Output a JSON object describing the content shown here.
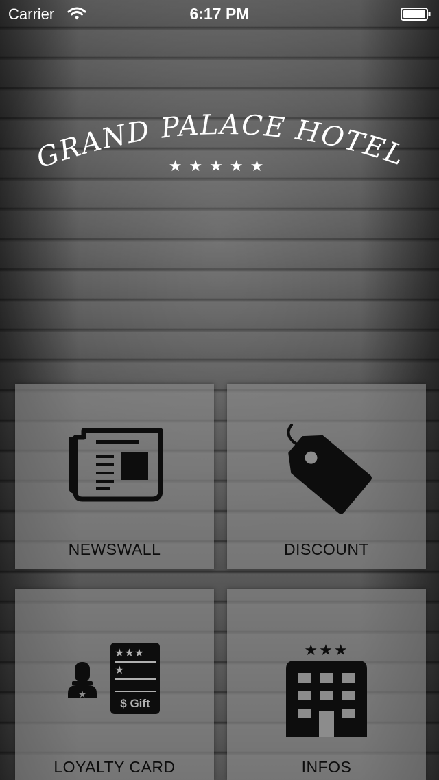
{
  "status_bar": {
    "carrier": "Carrier",
    "time": "6:17 PM",
    "wifi_icon": "wifi-icon",
    "battery_icon": "battery-full-icon",
    "battery_level": 1.0
  },
  "logo": {
    "title": "GRAND PALACE HOTEL",
    "stars": "★★★★★",
    "star_rating": 5
  },
  "tiles": [
    {
      "label": "NEWSWALL",
      "icon": "newspaper-icon"
    },
    {
      "label": "DISCOUNT",
      "icon": "price-tag-icon"
    },
    {
      "label": "LOYALTY CARD",
      "icon": "loyalty-card-icon",
      "card_text": "$ Gift"
    },
    {
      "label": "INFOS",
      "icon": "hotel-building-icon"
    }
  ],
  "colors": {
    "tile_background": "#8c8c8c",
    "icon_color": "#0d0d0d",
    "text_on_dark": "#ffffff"
  }
}
